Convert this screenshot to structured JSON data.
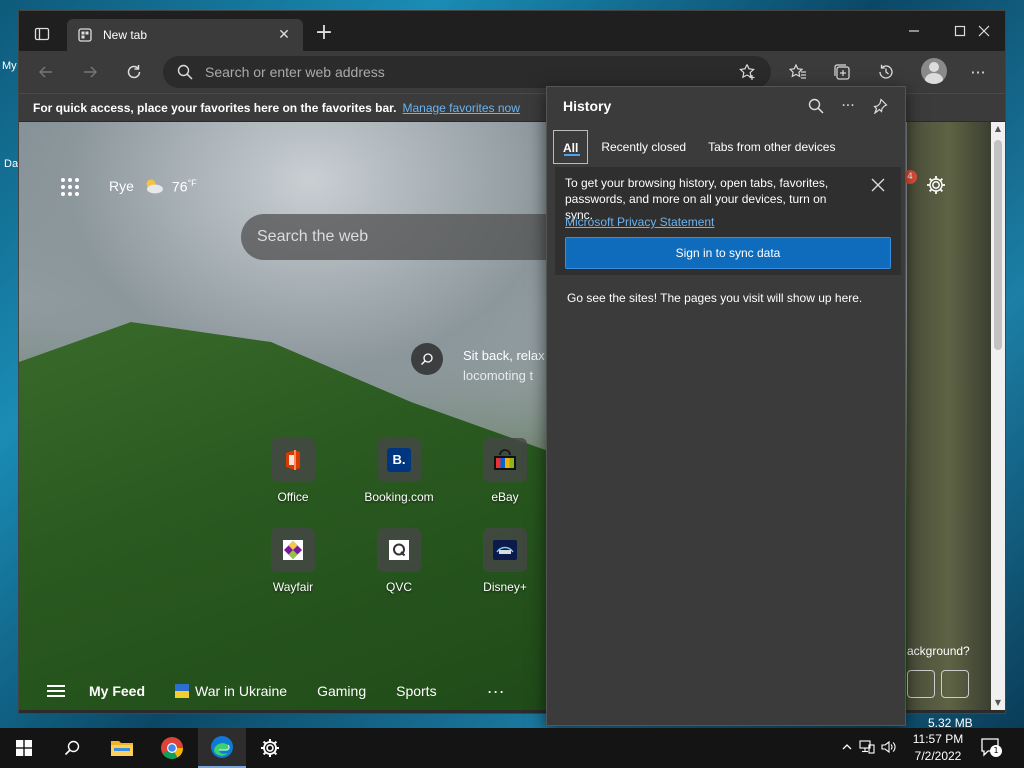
{
  "desktop": {
    "frag_top": "My",
    "frag_bottom": "Da"
  },
  "browser": {
    "tab_title": "New tab",
    "address_placeholder": "Search or enter web address",
    "favbar_message": "For quick access, place your favorites here on the favorites bar.",
    "favbar_link": "Manage favorites now"
  },
  "newtab": {
    "weather_city": "Rye",
    "weather_temp": "76",
    "weather_unit": "°F",
    "search_placeholder": "Search the web",
    "caption_line1": "Sit back, relax",
    "caption_line2": "locomoting t",
    "tiles": [
      {
        "label": "Office"
      },
      {
        "label": "Booking.com"
      },
      {
        "label": "eBay"
      },
      {
        "label": "Wayfair"
      },
      {
        "label": "QVC"
      },
      {
        "label": "Disney+"
      }
    ],
    "feed": {
      "my_feed": "My Feed",
      "war_in_ukraine": "War in Ukraine",
      "gaming": "Gaming",
      "sports": "Sports",
      "more": "···"
    },
    "notif_count": "4",
    "bg_question": "ackground?"
  },
  "history": {
    "title": "History",
    "tabs": [
      "All",
      "Recently closed",
      "Tabs from other devices"
    ],
    "sync_text": "To get your browsing history, open tabs, favorites, passwords, and more on all your devices, turn on sync.",
    "privacy_link": "Microsoft Privacy Statement",
    "sync_button": "Sign in to sync data",
    "empty_message": "Go see the sites! The pages you visit will show up here."
  },
  "status_size": "5.32 MB",
  "taskbar": {
    "time": "11:57 PM",
    "date": "7/2/2022",
    "notif_count": "1"
  },
  "colors": {
    "accent": "#0f6cbd",
    "link": "#6bb3f0",
    "panel_bg": "#3b3b3b"
  }
}
